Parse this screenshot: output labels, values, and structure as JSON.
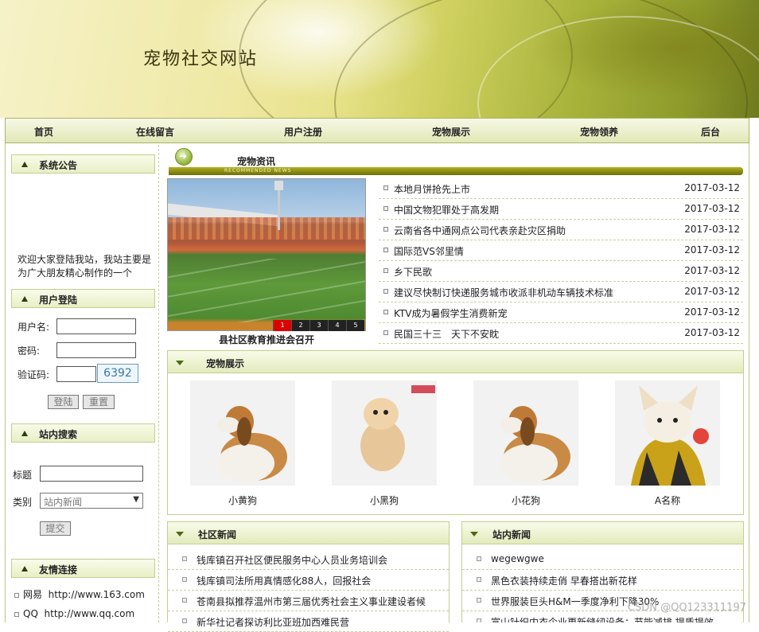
{
  "site": {
    "title": "宠物社交网站"
  },
  "nav": [
    "首页",
    "在线留言",
    "用户注册",
    "宠物展示",
    "宠物领养",
    "后台"
  ],
  "sidebar": {
    "notice": {
      "title": "系统公告",
      "text": "欢迎大家登陆我站，我站主要是为广大朋友精心制作的一个"
    },
    "login": {
      "title": "用户登陆",
      "username_label": "用户名:",
      "password_label": "密码:",
      "captcha_label": "验证码:",
      "captcha_code": "6392",
      "login_button": "登陆",
      "reset_button": "重置"
    },
    "search": {
      "title": "站内搜索",
      "title_label": "标题",
      "type_label": "类别",
      "type_selected": "站内新闻",
      "submit_button": "提交"
    },
    "links": {
      "title": "友情连接",
      "items": [
        {
          "name": "网易",
          "url": "http://www.163.com"
        },
        {
          "name": "QQ",
          "url": "http://www.qq.com"
        }
      ]
    }
  },
  "news": {
    "title": "宠物资讯",
    "subtitle": "RECOMMENDED NEWS",
    "photo_caption": "县社区教育推进会召开",
    "pager": [
      "1",
      "2",
      "3",
      "4",
      "5"
    ],
    "items": [
      {
        "title": "本地月饼抢先上市",
        "date": "2017-03-12"
      },
      {
        "title": "中国文物犯罪处于高发期",
        "date": "2017-03-12"
      },
      {
        "title": "云南省各中通网点公司代表亲赴灾区捐助",
        "date": "2017-03-12"
      },
      {
        "title": "国际范VS邻里情",
        "date": "2017-03-12"
      },
      {
        "title": "乡下民歌",
        "date": "2017-03-12"
      },
      {
        "title": "建议尽快制订快递服务城市收派非机动车辆技术标准",
        "date": "2017-03-12"
      },
      {
        "title": "KTV成为暑假学生消费新宠",
        "date": "2017-03-12"
      },
      {
        "title": "民国三十三　天下不安眈",
        "date": "2017-03-12"
      }
    ]
  },
  "pets": {
    "title": "宠物展示",
    "items": [
      "小黄狗",
      "小黑狗",
      "小花狗",
      "A名称"
    ]
  },
  "community_news": {
    "title": "社区新闻",
    "items": [
      "钱库镇召开社区便民服务中心人员业务培训会",
      "钱库镇司法所用真情感化88人，回报社会",
      "苍南县拟推荐温州市第三届优秀社会主义事业建设者候",
      "新华社记者探访利比亚班加西难民营"
    ]
  },
  "site_news": {
    "title": "站内新闻",
    "items": [
      "wegewgwe",
      "黑色衣装持续走俏 早春搭出新花样",
      "世界服装巨头H&M一季度净利下降30%",
      "富山针织内衣企业更新缝纫设备：节能减排 提质提效"
    ]
  },
  "watermark": "CSDN @QQ123311197"
}
